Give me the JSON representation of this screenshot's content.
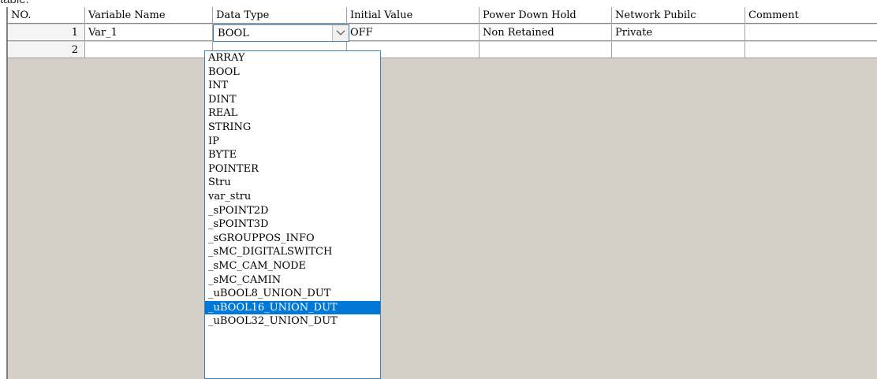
{
  "top_text": "table:",
  "columns": [
    "NO.",
    "Variable Name",
    "Data Type",
    "Initial Value",
    "Power Down Hold",
    "Network Pubilc",
    "Comment"
  ],
  "rows": [
    {
      "no": "1",
      "variable_name": "Var_1",
      "data_type": "BOOL",
      "initial_value": "OFF",
      "power_down_hold": "Non Retained",
      "network_public": "Private",
      "comment": ""
    },
    {
      "no": "2",
      "variable_name": "",
      "data_type": "",
      "initial_value": "",
      "power_down_hold": "",
      "network_public": "",
      "comment": ""
    }
  ],
  "dropdown": {
    "options": [
      "ARRAY",
      "BOOL",
      "INT",
      "DINT",
      "REAL",
      "STRING",
      "IP",
      "BYTE",
      "POINTER",
      "Stru",
      "var_stru",
      "_sPOINT2D",
      "_sPOINT3D",
      "_sGROUPPOS_INFO",
      "_sMC_DIGITALSWITCH",
      "_sMC_CAM_NODE",
      "_sMC_CAMIN",
      "_uBOOL8_UNION_DUT",
      "_uBOOL16_UNION_DUT",
      "_uBOOL32_UNION_DUT"
    ],
    "selected": "_uBOOL16_UNION_DUT"
  },
  "icons": {
    "dropdown_button": "chevron-down-icon"
  },
  "colors": {
    "selection": "#0078d7",
    "focus_border": "#3c7fb1",
    "background_area": "#d4d0c8"
  }
}
